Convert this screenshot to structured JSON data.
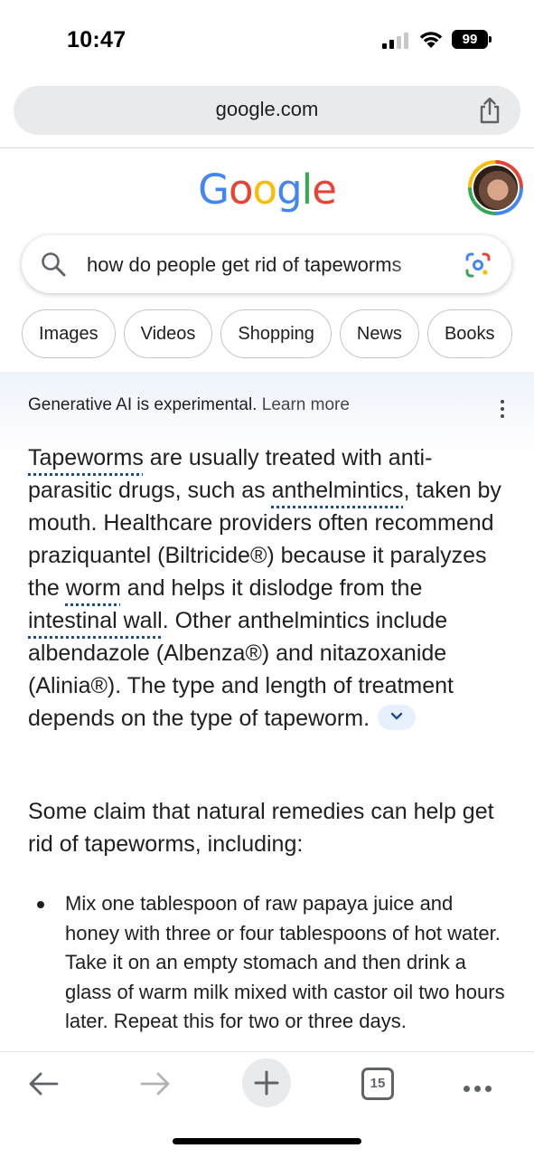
{
  "status_bar": {
    "time": "10:47",
    "battery": "99"
  },
  "browser": {
    "url": "google.com",
    "tab_count": "15"
  },
  "google": {
    "logo_letters": [
      "G",
      "o",
      "o",
      "g",
      "l",
      "e"
    ],
    "search_query": "how do people get rid of tapeworms",
    "chips": [
      "Images",
      "Videos",
      "Shopping",
      "News",
      "Books"
    ]
  },
  "ai_overview": {
    "notice": "Generative AI is experimental.",
    "learn_more": "Learn more",
    "p1": {
      "t1": "Tapeworms",
      "t2": " are usually treated with anti-parasitic drugs, such as ",
      "t3": "anthelmintics",
      "t4": ", taken by mouth. Healthcare providers often recommend praziquantel (Biltricide®) because it paralyzes the ",
      "t5": "worm",
      "t6": " and helps it dislodge from the ",
      "t7": "intestinal wall",
      "t8": ". Other anthelmintics include albendazole (Albenza®) and nitazoxanide (Alinia®). The type and length of treatment depends on the type of tapeworm. "
    },
    "p2": "Some claim that natural remedies can help get rid of tapeworms, including:",
    "bullet1": "Mix one tablespoon of raw papaya juice and honey with three or four tablespoons of hot water. Take it on an empty stomach and then drink a glass of warm milk mixed with castor oil two hours later. Repeat this for two or three days."
  },
  "colors": {
    "google_blue": "#4285f4",
    "google_red": "#ea4335",
    "google_yellow": "#fbbc05",
    "google_green": "#34a853",
    "link_underline": "#1a4f8b"
  }
}
